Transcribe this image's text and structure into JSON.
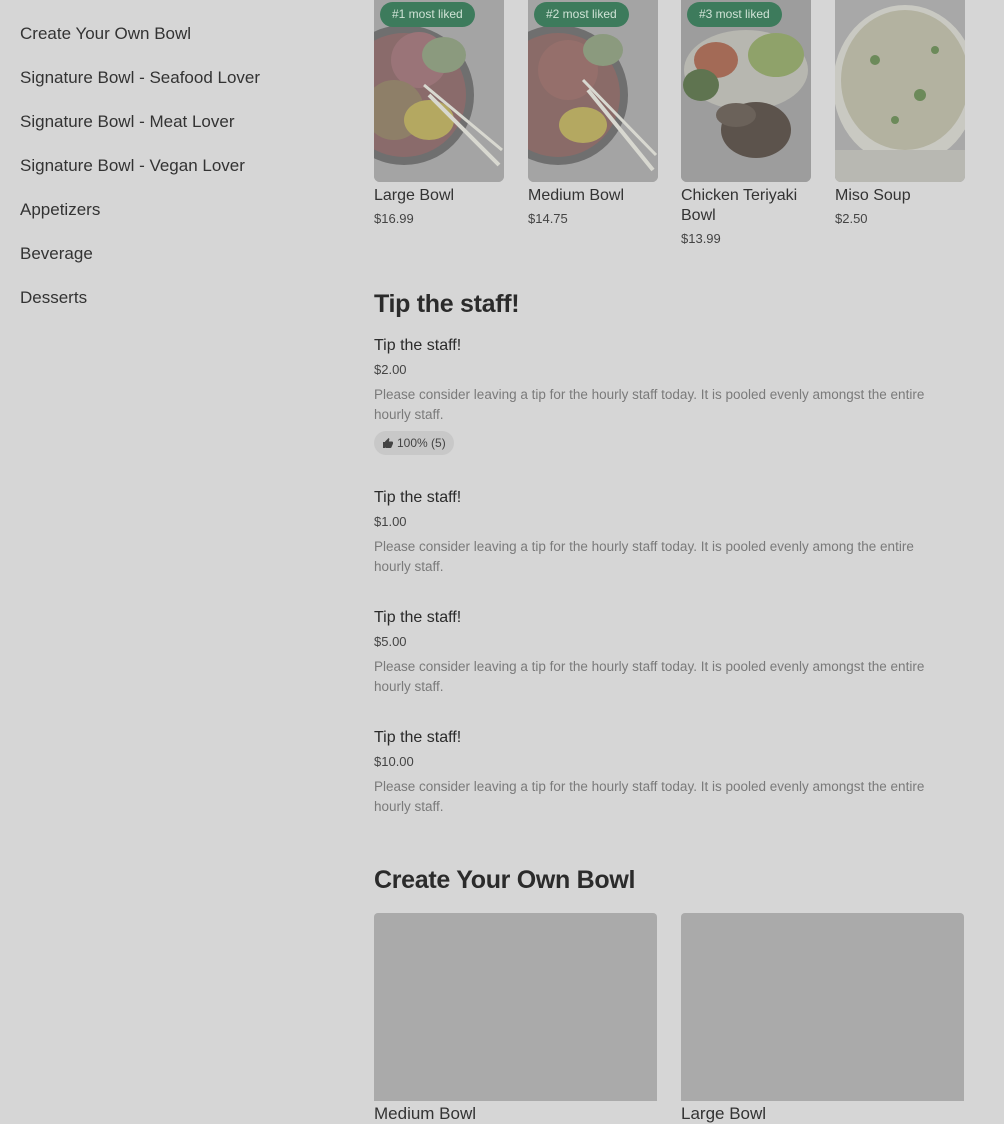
{
  "sidebar": {
    "items": [
      {
        "label": "Create Your Own Bowl"
      },
      {
        "label": "Signature Bowl - Seafood Lover"
      },
      {
        "label": "Signature Bowl - Meat Lover"
      },
      {
        "label": "Signature Bowl - Vegan Lover"
      },
      {
        "label": "Appetizers"
      },
      {
        "label": "Beverage"
      },
      {
        "label": "Desserts"
      }
    ]
  },
  "popular": {
    "items": [
      {
        "badge": "#1 most liked",
        "name": "Large Bowl",
        "price": "$16.99",
        "image": "poke-bowl-image"
      },
      {
        "badge": "#2 most liked",
        "name": "Medium Bowl",
        "price": "$14.75",
        "image": "poke-bowl-image"
      },
      {
        "badge": "#3 most liked",
        "name": "Chicken Teriyaki Bowl",
        "price": "$13.99",
        "image": "chicken-teriyaki-image"
      },
      {
        "badge": "",
        "name": "Miso Soup",
        "price": "$2.50",
        "image": "miso-soup-image"
      }
    ]
  },
  "tip_section": {
    "title": "Tip the staff!",
    "items": [
      {
        "name": "Tip the staff!",
        "price": "$2.00",
        "description": "Please consider leaving a tip for the hourly staff today. It is pooled evenly amongst the entire hourly staff.",
        "rating": "100% (5)"
      },
      {
        "name": "Tip the staff!",
        "price": "$1.00",
        "description": "Please consider leaving a tip for the hourly staff today. It is pooled evenly among the entire hourly staff."
      },
      {
        "name": "Tip the staff!",
        "price": "$5.00",
        "description": "Please consider leaving a tip for the hourly staff today. It is pooled evenly amongst the entire hourly staff."
      },
      {
        "name": "Tip the staff!",
        "price": "$10.00",
        "description": "Please consider leaving a tip for the hourly staff today. It is pooled evenly amongst the entire hourly staff."
      }
    ]
  },
  "cyob_section": {
    "title": "Create Your Own Bowl",
    "items": [
      {
        "name": "Medium Bowl"
      },
      {
        "name": "Large Bowl"
      }
    ]
  },
  "icons": {
    "rating": "thumbs-up-icon"
  },
  "colors": {
    "overlay_bg": "#d6d6d6",
    "badge_bg": "#3d7b5c",
    "badge_text": "#cfe3d6"
  }
}
